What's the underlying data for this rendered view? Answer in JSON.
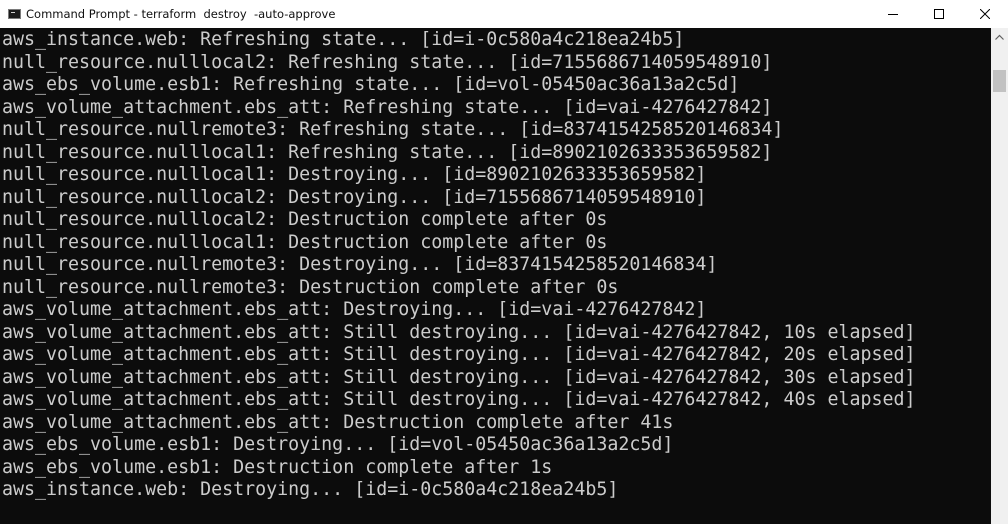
{
  "window": {
    "title": "Command Prompt - terraform  destroy  -auto-approve",
    "icon": "cmd-icon",
    "controls": {
      "minimize_icon": "minimize-icon",
      "maximize_icon": "maximize-icon",
      "close_icon": "close-icon"
    }
  },
  "colors": {
    "terminal_bg": "#0c0c0c",
    "terminal_fg": "#cccccc",
    "titlebar_bg": "#ffffff",
    "scrollbar_bg": "#f0f0f0"
  },
  "terminal": {
    "lines": [
      "aws_instance.web: Refreshing state... [id=i-0c580a4c218ea24b5]",
      "null_resource.nulllocal2: Refreshing state... [id=7155686714059548910]",
      "aws_ebs_volume.esb1: Refreshing state... [id=vol-05450ac36a13a2c5d]",
      "aws_volume_attachment.ebs_att: Refreshing state... [id=vai-4276427842]",
      "null_resource.nullremote3: Refreshing state... [id=8374154258520146834]",
      "null_resource.nulllocal1: Refreshing state... [id=8902102633353659582]",
      "null_resource.nulllocal1: Destroying... [id=8902102633353659582]",
      "null_resource.nulllocal2: Destroying... [id=7155686714059548910]",
      "null_resource.nulllocal2: Destruction complete after 0s",
      "null_resource.nulllocal1: Destruction complete after 0s",
      "null_resource.nullremote3: Destroying... [id=8374154258520146834]",
      "null_resource.nullremote3: Destruction complete after 0s",
      "aws_volume_attachment.ebs_att: Destroying... [id=vai-4276427842]",
      "aws_volume_attachment.ebs_att: Still destroying... [id=vai-4276427842, 10s elapsed]",
      "aws_volume_attachment.ebs_att: Still destroying... [id=vai-4276427842, 20s elapsed]",
      "aws_volume_attachment.ebs_att: Still destroying... [id=vai-4276427842, 30s elapsed]",
      "aws_volume_attachment.ebs_att: Still destroying... [id=vai-4276427842, 40s elapsed]",
      "aws_volume_attachment.ebs_att: Destruction complete after 41s",
      "aws_ebs_volume.esb1: Destroying... [id=vol-05450ac36a13a2c5d]",
      "aws_ebs_volume.esb1: Destruction complete after 1s",
      "aws_instance.web: Destroying... [id=i-0c580a4c218ea24b5]"
    ]
  }
}
